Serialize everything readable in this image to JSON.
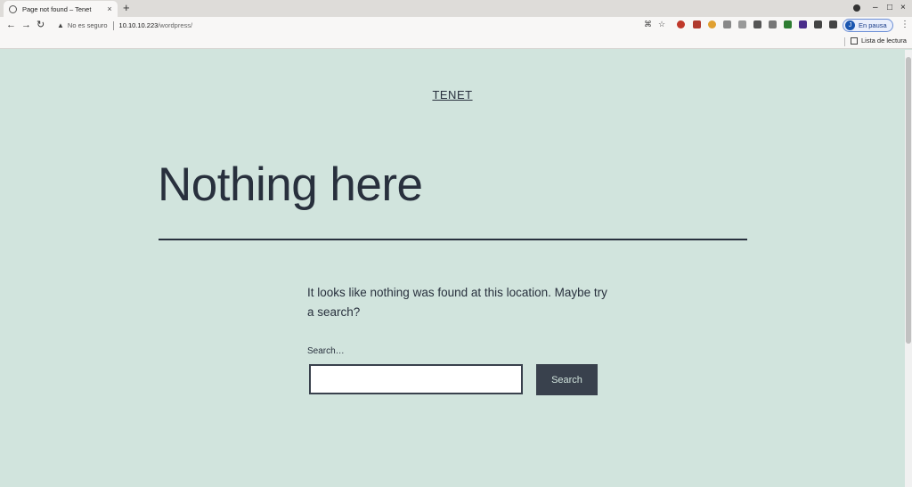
{
  "browser": {
    "tab": {
      "title": "Page not found – Tenet",
      "close": "×"
    },
    "new_tab": "+",
    "window_controls": {
      "minimize": "–",
      "maximize": "□",
      "close": "×"
    },
    "nav": {
      "back": "←",
      "forward": "→",
      "reload": "↻"
    },
    "address": {
      "security_text": "No es seguro",
      "host": "10.10.10.223",
      "path": "/wordpress/"
    },
    "extensions": [
      {
        "icon": "wappalyzer-icon",
        "color": "#c0392b"
      },
      {
        "icon": "ublock-icon",
        "color": "#b03a2e"
      },
      {
        "icon": "cookie-icon",
        "color": "#e0a030"
      },
      {
        "icon": "extension-gray-icon",
        "color": "#888888"
      },
      {
        "icon": "extension-gray2-icon",
        "color": "#999999"
      },
      {
        "icon": "wolf-icon",
        "color": "#555555"
      },
      {
        "icon": "robot-icon",
        "color": "#777777"
      },
      {
        "icon": "bw-icon",
        "color": "#2e7d32"
      },
      {
        "icon": "hex-icon",
        "color": "#4a2d8a"
      },
      {
        "icon": "puzzle-icon",
        "color": "#444444"
      },
      {
        "icon": "media-icon",
        "color": "#444444"
      }
    ],
    "profile": {
      "avatar_letter": "J",
      "label": "En pausa"
    },
    "menu": "⋮",
    "bookmarks": {
      "reading_list": "Lista de lectura"
    }
  },
  "page": {
    "site_title": "TENET",
    "heading": "Nothing here",
    "message": "It looks like nothing was found at this location. Maybe try a search?",
    "search": {
      "label": "Search…",
      "input_value": "",
      "button_label": "Search"
    }
  },
  "colors": {
    "background": "#d1e4dd",
    "text": "#28303d",
    "button": "#39414d"
  }
}
